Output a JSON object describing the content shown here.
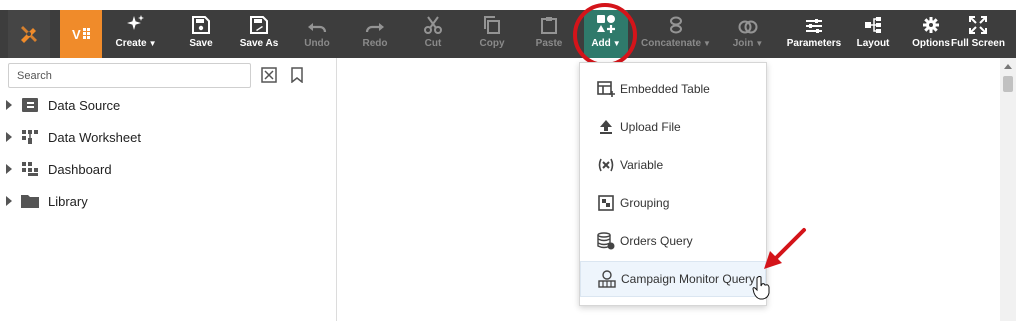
{
  "toolbar": {
    "create": "Create",
    "save": "Save",
    "save_as": "Save As",
    "undo": "Undo",
    "redo": "Redo",
    "cut": "Cut",
    "copy": "Copy",
    "paste": "Paste",
    "add": "Add",
    "concatenate": "Concatenate",
    "join": "Join",
    "parameters": "Parameters",
    "layout": "Layout",
    "options": "Options",
    "full_screen": "Full Screen"
  },
  "left_panel": {
    "search_placeholder": "Search",
    "tree": [
      {
        "label": "Data Source",
        "icon": "data-source-icon"
      },
      {
        "label": "Data Worksheet",
        "icon": "data-worksheet-icon"
      },
      {
        "label": "Dashboard",
        "icon": "dashboard-icon"
      },
      {
        "label": "Library",
        "icon": "folder-icon"
      }
    ]
  },
  "add_menu": {
    "items": [
      {
        "label": "Embedded Table",
        "icon": "embedded-table-icon"
      },
      {
        "label": "Upload File",
        "icon": "upload-icon"
      },
      {
        "label": "Variable",
        "icon": "variable-icon"
      },
      {
        "label": "Grouping",
        "icon": "grouping-icon"
      },
      {
        "label": "Orders Query",
        "icon": "database-query-icon"
      },
      {
        "label": "Campaign Monitor Query",
        "icon": "campaign-monitor-icon"
      }
    ],
    "hovered_item": "Campaign Monitor Query"
  },
  "colors": {
    "toolbar_bg": "#3d3d3d",
    "brand_orange": "#f08b2a",
    "add_active": "#2f7a6b",
    "annotation_red": "#d4141a"
  }
}
